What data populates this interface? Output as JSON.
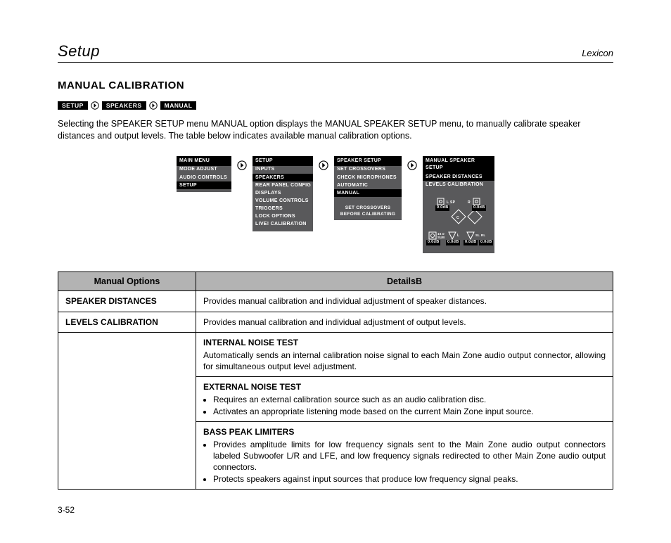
{
  "header": {
    "left": "Setup",
    "right": "Lexicon"
  },
  "section_title": "MANUAL CALIBRATION",
  "breadcrumb": [
    "SETUP",
    "SPEAKERS",
    "MANUAL"
  ],
  "intro": "Selecting the SPEAKER SETUP menu MANUAL option displays the MANUAL SPEAKER SETUP menu, to manually calibrate speaker distances and output levels. The table below indicates available manual calibration options.",
  "menus": {
    "main_menu": {
      "title": "MAIN MENU",
      "items": [
        "MODE ADJUST",
        "AUDIO CONTROLS",
        "SETUP"
      ],
      "selected": "SETUP"
    },
    "setup": {
      "title": "SETUP",
      "items": [
        "INPUTS",
        "SPEAKERS",
        "REAR PANEL CONFIG",
        "DISPLAYS",
        "VOLUME CONTROLS",
        "TRIGGERS",
        "LOCK OPTIONS",
        "LIVE! CALIBRATION"
      ],
      "selected": "SPEAKERS"
    },
    "speaker_setup": {
      "title": "SPEAKER SETUP",
      "items": [
        "SET CROSSOVERS",
        "CHECK MICROPHONES",
        "AUTOMATIC",
        "MANUAL"
      ],
      "selected": "MANUAL",
      "note_line1": "SET CROSSOVERS",
      "note_line2": "BEFORE CALIBRATING"
    },
    "manual_speaker_setup": {
      "title": "MANUAL SPEAKER SETUP",
      "items": [
        "SPEAKER DISTANCES",
        "LEVELS CALIBRATION"
      ],
      "selected": "SPEAKER DISTANCES",
      "graphic_labels": {
        "left_front": "0.0dB",
        "right_front": "0.0dB",
        "center": "C",
        "sub": "10.0 SUB",
        "sub_db": "0.0dB",
        "sl": "0.0dB",
        "sr": "0.0dB",
        "rl": "0.0dB",
        "l_spk": "L   SP",
        "r_spk": "R"
      }
    }
  },
  "table": {
    "headers": [
      "Manual Options",
      "DetailsB"
    ],
    "rows": [
      {
        "label": "SPEAKER DISTANCES",
        "text": "Provides manual calibration and individual adjustment of speaker distances."
      },
      {
        "label": "LEVELS CALIBRATION",
        "text": "Provides manual calibration and individual adjustment of output levels."
      }
    ],
    "subsections": {
      "internal_noise_test": {
        "title": "INTERNAL NOISE TEST",
        "body": "Automatically sends an internal calibration noise signal to each Main Zone audio output connector, allowing for simultaneous output level adjustment."
      },
      "external_noise_test": {
        "title": "EXTERNAL NOISE TEST",
        "bullets": [
          "Requires an external calibration source such as an audio calibration disc.",
          "Activates an appropriate listening mode based on the current Main Zone input source."
        ]
      },
      "bass_peak_limiters": {
        "title": "BASS PEAK LIMITERS",
        "bullets": [
          "Provides amplitude limits for low frequency signals sent to the Main Zone audio output connectors labeled Subwoofer L/R and LFE, and low frequency signals redirected to other Main Zone audio output connectors.",
          "Protects speakers against input sources that produce low frequency signal peaks."
        ]
      }
    }
  },
  "footer": "3-52"
}
